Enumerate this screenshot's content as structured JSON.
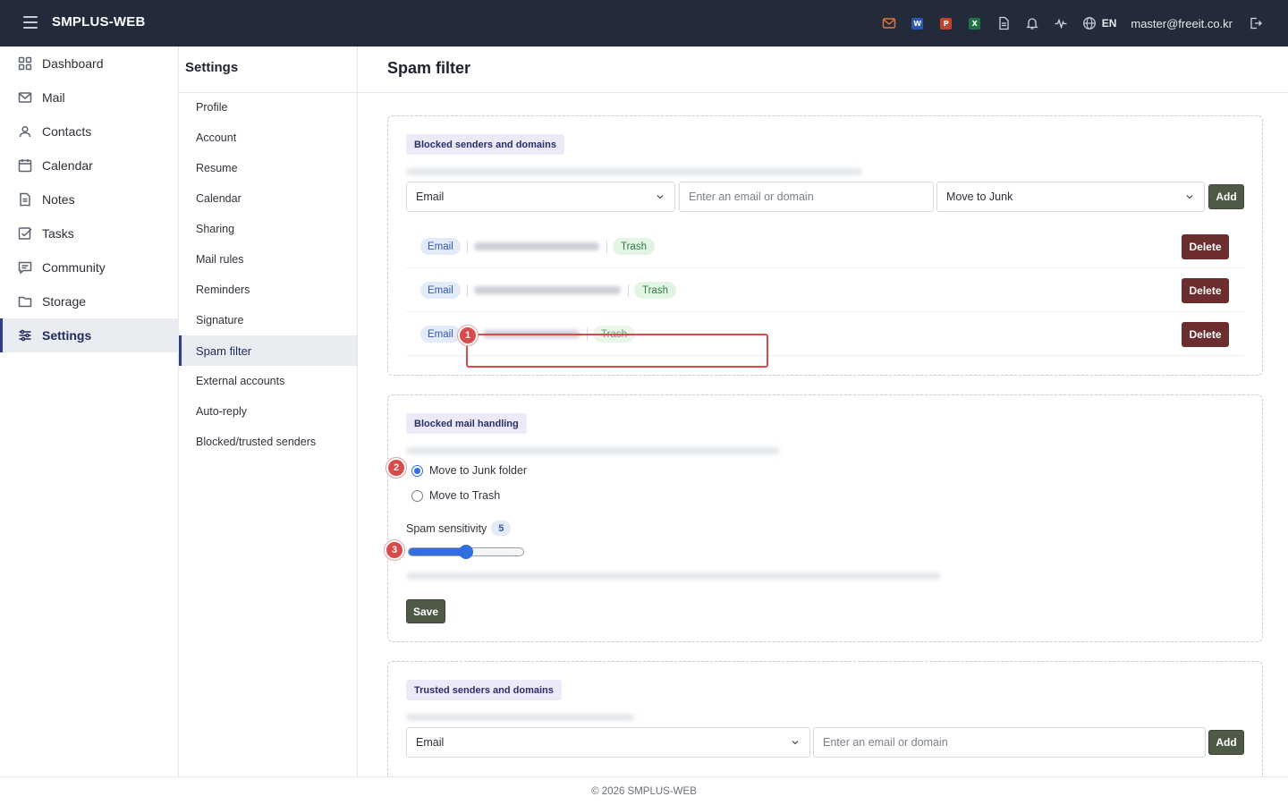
{
  "app": {
    "title": "SMPLUS-WEB",
    "footer": "© 2026 SMPLUS-WEB"
  },
  "header": {
    "icons": [
      "mail-icon",
      "word-icon",
      "powerpoint-icon",
      "excel-icon",
      "document-icon",
      "bell-icon",
      "activity-icon",
      "globe-icon"
    ],
    "app_badges": {
      "word": "W",
      "powerpoint": "P",
      "excel": "X"
    },
    "language": "EN",
    "user_email": "master@freeit.co.kr",
    "colors": {
      "mail": "#e8763a",
      "word": "#2b57b3",
      "powerpoint": "#c0432c",
      "excel": "#217346"
    }
  },
  "sidebar": {
    "items": [
      {
        "label": "Dashboard",
        "icon": "grid-icon"
      },
      {
        "label": "Mail",
        "icon": "mail-icon"
      },
      {
        "label": "Contacts",
        "icon": "contacts-icon"
      },
      {
        "label": "Calendar",
        "icon": "calendar-icon"
      },
      {
        "label": "Notes",
        "icon": "notes-icon"
      },
      {
        "label": "Tasks",
        "icon": "tasks-icon"
      },
      {
        "label": "Community",
        "icon": "community-icon"
      },
      {
        "label": "Storage",
        "icon": "folder-icon"
      },
      {
        "label": "Settings",
        "icon": "settings-sliders-icon",
        "active": true
      }
    ]
  },
  "settings_nav": {
    "title": "Settings",
    "items": [
      "Profile",
      "Account",
      "Resume",
      "Calendar",
      "Sharing",
      "Mail rules",
      "Reminders",
      "Signature",
      "Spam filter",
      "External accounts",
      "Auto-reply",
      "Blocked/trusted senders"
    ],
    "active": "Spam filter"
  },
  "main": {
    "title": "Spam filter",
    "blocked": {
      "title": "Blocked senders and domains",
      "type_select": "Email",
      "input_placeholder": "Enter an email or domain",
      "action_select": "Move to Junk",
      "add_label": "Add",
      "rows": [
        {
          "type": "Email",
          "action": "Trash",
          "delete_label": "Delete"
        },
        {
          "type": "Email",
          "action": "Trash",
          "delete_label": "Delete"
        },
        {
          "type": "Email",
          "action": "Trash",
          "delete_label": "Delete"
        }
      ]
    },
    "handling": {
      "title": "Blocked mail handling",
      "options": [
        {
          "label": "Move to Junk folder",
          "checked": true
        },
        {
          "label": "Move to Trash",
          "checked": false
        }
      ],
      "sensitivity_label": "Spam sensitivity",
      "sensitivity_value": "5",
      "sensitivity_fraction": 0.5,
      "save_label": "Save"
    },
    "trusted": {
      "title": "Trusted senders and domains",
      "type_select": "Email",
      "input_placeholder": "Enter an email or domain",
      "add_label": "Add"
    }
  },
  "annotations": [
    "1",
    "2",
    "3"
  ]
}
